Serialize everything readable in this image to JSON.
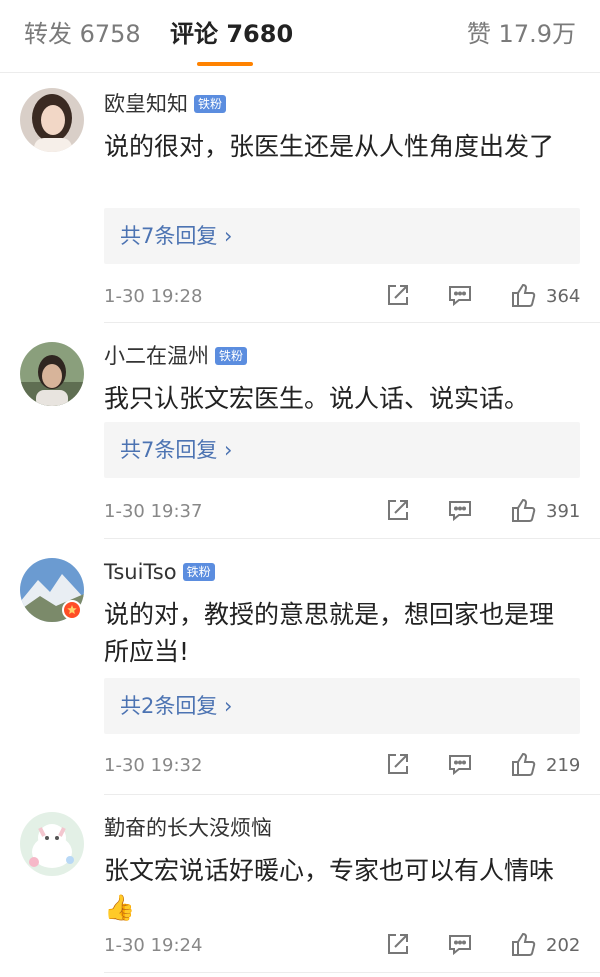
{
  "tabs": {
    "reposts": "转发 6758",
    "comments": "评论 7680",
    "likes": "赞 17.9万"
  },
  "comments": [
    {
      "username": "欧皇知知",
      "badge": "铁粉",
      "text": "说的很对，张医生还是从人性角度出发了",
      "replies_label": "共7条回复 ›",
      "time": "1-30 19:28",
      "likes": "364"
    },
    {
      "username": "小二在温州",
      "badge": "铁粉",
      "text": "我只认张文宏医生。说人话、说实话。",
      "replies_label": "共7条回复 ›",
      "time": "1-30 19:37",
      "likes": "391"
    },
    {
      "username": "TsuiTso",
      "badge": "铁粉",
      "text": "说的对，教授的意思就是，想回家也是理所应当!",
      "replies_label": "共2条回复 ›",
      "time": "1-30 19:32",
      "likes": "219"
    },
    {
      "username": "勤奋的长大没烦恼",
      "text": "张文宏说话好暖心，专家也可以有人情味👍",
      "time": "1-30 19:24",
      "likes": "202"
    }
  ],
  "colors": {
    "accent": "#ff8200",
    "link": "#4c73b2",
    "badge": "#5b8ddf"
  }
}
